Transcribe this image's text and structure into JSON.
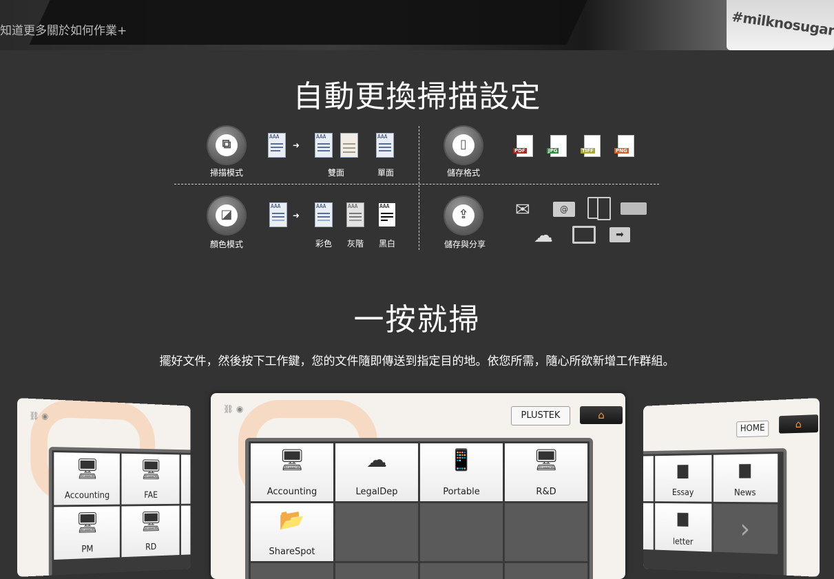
{
  "hero": {
    "more_link": "知道更多關於如何作業+",
    "cup_text": "#milknosugar"
  },
  "section1": {
    "title": "自動更換掃描設定",
    "scan_mode": {
      "label": "掃描模式",
      "duplex": "雙面",
      "simplex": "單面"
    },
    "save_format": {
      "label": "儲存格式",
      "formats": [
        "PDF",
        "JPG",
        "TIFF",
        "PNG"
      ]
    },
    "color_mode": {
      "label": "顏色模式",
      "color": "彩色",
      "gray": "灰階",
      "bw": "黑白"
    },
    "save_share": {
      "label": "儲存與分享"
    },
    "doc_text": "AAA"
  },
  "section2": {
    "title": "一按就掃",
    "description": "擺好文件，然後按下工作鍵，您的文件隨即傳送到指定目的地。依您所需，隨心所欲新增工作群組。"
  },
  "panel_left": {
    "cells": [
      "Accounting",
      "FAE",
      "PM",
      "RD"
    ]
  },
  "panel_center": {
    "brand_button": "PLUSTEK",
    "cells": [
      "Accounting",
      "LegalDep",
      "Portable",
      "R&D",
      "ShareSpot"
    ]
  },
  "panel_right": {
    "home_button": "HOME",
    "cells": [
      "Essay",
      "News",
      "letter"
    ]
  },
  "icons": [
    "mail-icon",
    "ftp-folder-icon",
    "mobile-icon",
    "usb-icon",
    "cloud-upload-icon",
    "monitor-icon",
    "folder-arrow-icon",
    "home-icon",
    "next-arrow-icon"
  ],
  "colors": {
    "background": "#333333",
    "accent": "#f39a3b"
  }
}
